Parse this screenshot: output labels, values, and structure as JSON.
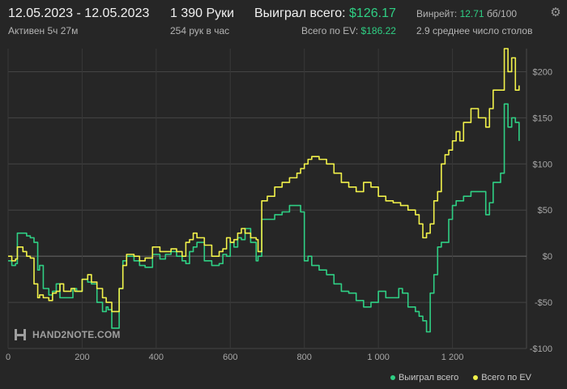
{
  "header": {
    "date_range": "12.05.2023 - 12.05.2023",
    "active_time": "Активен 5ч 27м",
    "hands": "1 390 Руки",
    "hands_per_hour": "254 рук в час",
    "won_total_label": "Выиграл всего:",
    "won_total_value": "$126.17",
    "ev_total_label": "Всего по EV:",
    "ev_total_value": "$186.22",
    "winrate_label": "Винрейт:",
    "winrate_value": "12.71",
    "winrate_unit": "бб/100",
    "avg_tables": "2.9 среднее число столов"
  },
  "icons": {
    "settings": "gear-icon",
    "brand_logo": "hand2note-logo-icon"
  },
  "watermark": {
    "brand": "HAND2NOTE.COM"
  },
  "colors": {
    "background": "#262626",
    "won_series": "#2fcf84",
    "ev_series": "#f1f14a",
    "accent_green": "#2fcf84"
  },
  "chart_data": {
    "type": "line",
    "xlabel": "",
    "ylabel": "",
    "xlim": [
      0,
      1400
    ],
    "ylim": [
      -100,
      225
    ],
    "x_ticks": [
      "0",
      "200",
      "400",
      "600",
      "800",
      "1 000",
      "1 200"
    ],
    "x_tick_values": [
      0,
      200,
      400,
      600,
      800,
      1000,
      1200
    ],
    "y_ticks": [
      "$200",
      "$150",
      "$100",
      "$50",
      "$0",
      "-$50",
      "-$100"
    ],
    "y_tick_values": [
      200,
      150,
      100,
      50,
      0,
      -50,
      -100
    ],
    "grid": true,
    "legend_position": "bottom-right",
    "series": [
      {
        "name": "Выиграл всего",
        "x": [
          0,
          10,
          20,
          25,
          50,
          60,
          70,
          80,
          85,
          95,
          110,
          120,
          130,
          140,
          150,
          160,
          175,
          185,
          200,
          215,
          225,
          240,
          255,
          265,
          270,
          280,
          300,
          310,
          320,
          340,
          355,
          370,
          390,
          410,
          425,
          440,
          455,
          470,
          480,
          490,
          500,
          510,
          530,
          550,
          570,
          580,
          590,
          600,
          610,
          620,
          630,
          640,
          655,
          670,
          675,
          685,
          700,
          720,
          740,
          760,
          780,
          790,
          800,
          810,
          820,
          840,
          860,
          880,
          900,
          920,
          940,
          960,
          980,
          1000,
          1020,
          1040,
          1055,
          1065,
          1080,
          1100,
          1110,
          1120,
          1130,
          1140,
          1150,
          1160,
          1170,
          1180,
          1190,
          1200,
          1210,
          1230,
          1250,
          1270,
          1290,
          1300,
          1310,
          1320,
          1330,
          1340,
          1350,
          1360,
          1370,
          1380
        ],
        "values": [
          -5,
          -10,
          -8,
          25,
          22,
          20,
          15,
          -15,
          -10,
          -35,
          -42,
          -38,
          -30,
          -45,
          -45,
          -45,
          -35,
          -38,
          -25,
          -28,
          -30,
          -50,
          -60,
          -55,
          -58,
          -78,
          -35,
          -5,
          0,
          -5,
          -10,
          -12,
          2,
          -3,
          2,
          5,
          0,
          -5,
          -8,
          5,
          10,
          15,
          -5,
          -10,
          -8,
          2,
          0,
          15,
          10,
          20,
          18,
          30,
          15,
          -5,
          0,
          40,
          40,
          45,
          48,
          55,
          55,
          48,
          -5,
          0,
          -10,
          -15,
          -20,
          -30,
          -38,
          -40,
          -48,
          -55,
          -50,
          -38,
          -45,
          -45,
          -35,
          -40,
          -55,
          -60,
          -65,
          -70,
          -82,
          -40,
          -20,
          10,
          15,
          15,
          40,
          55,
          60,
          65,
          70,
          70,
          45,
          58,
          80,
          80,
          90,
          165,
          140,
          150,
          145,
          125
        ]
      },
      {
        "name": "Всего по EV",
        "x": [
          0,
          10,
          20,
          25,
          40,
          50,
          60,
          70,
          80,
          85,
          95,
          110,
          120,
          130,
          140,
          150,
          170,
          180,
          200,
          215,
          225,
          240,
          255,
          265,
          280,
          300,
          310,
          320,
          340,
          355,
          370,
          390,
          410,
          425,
          440,
          455,
          470,
          480,
          490,
          500,
          510,
          530,
          550,
          570,
          580,
          590,
          600,
          610,
          620,
          630,
          640,
          655,
          670,
          675,
          685,
          700,
          720,
          740,
          760,
          780,
          790,
          800,
          810,
          820,
          840,
          860,
          880,
          900,
          920,
          940,
          960,
          980,
          1000,
          1020,
          1040,
          1060,
          1080,
          1100,
          1110,
          1120,
          1130,
          1140,
          1150,
          1160,
          1170,
          1180,
          1190,
          1200,
          1210,
          1220,
          1230,
          1250,
          1270,
          1290,
          1300,
          1310,
          1330,
          1340,
          1350,
          1360,
          1370,
          1380
        ],
        "values": [
          0,
          -5,
          -3,
          10,
          5,
          0,
          -2,
          -30,
          -45,
          -42,
          -45,
          -48,
          -40,
          -38,
          -30,
          -38,
          -35,
          -38,
          -25,
          -20,
          -28,
          -35,
          -45,
          -50,
          -60,
          -35,
          -10,
          2,
          0,
          -5,
          -2,
          10,
          5,
          5,
          8,
          5,
          0,
          15,
          18,
          25,
          20,
          12,
          0,
          5,
          8,
          20,
          15,
          18,
          25,
          30,
          25,
          20,
          18,
          5,
          60,
          65,
          75,
          80,
          85,
          90,
          95,
          100,
          105,
          108,
          105,
          100,
          90,
          80,
          75,
          70,
          80,
          75,
          65,
          60,
          58,
          55,
          50,
          45,
          35,
          20,
          25,
          35,
          60,
          70,
          100,
          110,
          115,
          125,
          135,
          125,
          145,
          160,
          150,
          140,
          160,
          180,
          180,
          225,
          200,
          215,
          180,
          185
        ]
      }
    ]
  }
}
